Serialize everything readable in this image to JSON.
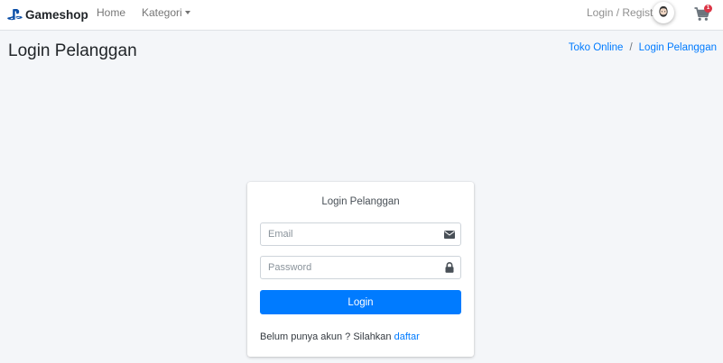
{
  "navbar": {
    "brand": "Gameshop",
    "home": "Home",
    "kategori": "Kategori",
    "login_register": "Login / Register",
    "cart_count": "1"
  },
  "header": {
    "title": "Login Pelanggan",
    "breadcrumb": [
      "Toko Online",
      "Login Pelanggan"
    ]
  },
  "login_card": {
    "title": "Login Pelanggan",
    "email_placeholder": "Email",
    "password_placeholder": "Password",
    "login_button": "Login",
    "register_prompt": "Belum punya akun ? Silahkan",
    "register_link": "daftar"
  },
  "colors": {
    "primary": "#007bff",
    "badge": "#dc3545",
    "background": "#f4f6f9"
  }
}
